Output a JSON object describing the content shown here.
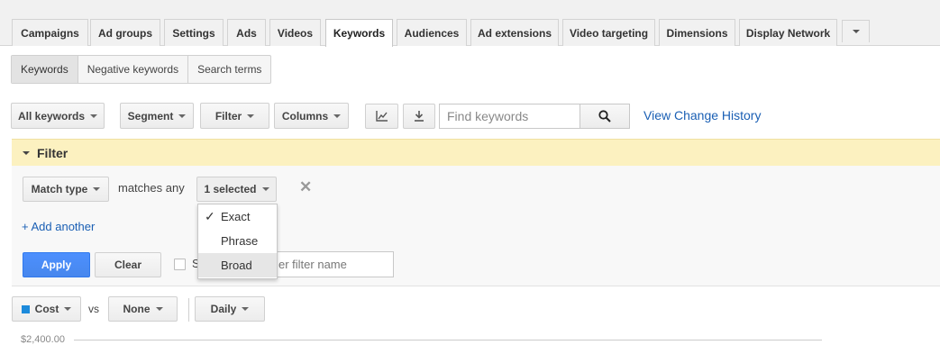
{
  "tabs": [
    {
      "label": "Campaigns"
    },
    {
      "label": "Ad groups"
    },
    {
      "label": "Settings"
    },
    {
      "label": "Ads"
    },
    {
      "label": "Videos"
    },
    {
      "label": "Keywords",
      "active": true
    },
    {
      "label": "Audiences"
    },
    {
      "label": "Ad extensions"
    },
    {
      "label": "Video targeting"
    },
    {
      "label": "Dimensions"
    },
    {
      "label": "Display Network"
    }
  ],
  "subtabs": [
    {
      "label": "Keywords",
      "active": true
    },
    {
      "label": "Negative keywords"
    },
    {
      "label": "Search terms"
    }
  ],
  "toolbar": {
    "all_keywords": "All keywords",
    "segment": "Segment",
    "filter": "Filter",
    "columns": "Columns",
    "search_placeholder": "Find keywords",
    "view_change_history": "View Change History",
    "icons": [
      "line-chart-icon",
      "download-icon",
      "search-icon"
    ]
  },
  "filter": {
    "header": "Filter",
    "match_type": "Match type",
    "matches_any": "matches any",
    "selected": "1 selected",
    "add_another": "+ Add another",
    "apply": "Apply",
    "clear": "Clear",
    "save_partial": "S",
    "filter_name_placeholder": "er filter name",
    "options": [
      {
        "label": "Exact",
        "checked": true
      },
      {
        "label": "Phrase",
        "checked": false
      },
      {
        "label": "Broad",
        "checked": false,
        "hovered": true
      }
    ]
  },
  "chart_controls": {
    "metric1": "Cost",
    "vs": "vs",
    "metric2": "None",
    "interval": "Daily",
    "metric1_color": "#1c8adb",
    "axis_top_label": "$2,400.00"
  },
  "colors": {
    "accent_blue": "#4d90fe",
    "link_blue": "#1a5fb4",
    "filter_header_bg": "#fcf1c0"
  }
}
